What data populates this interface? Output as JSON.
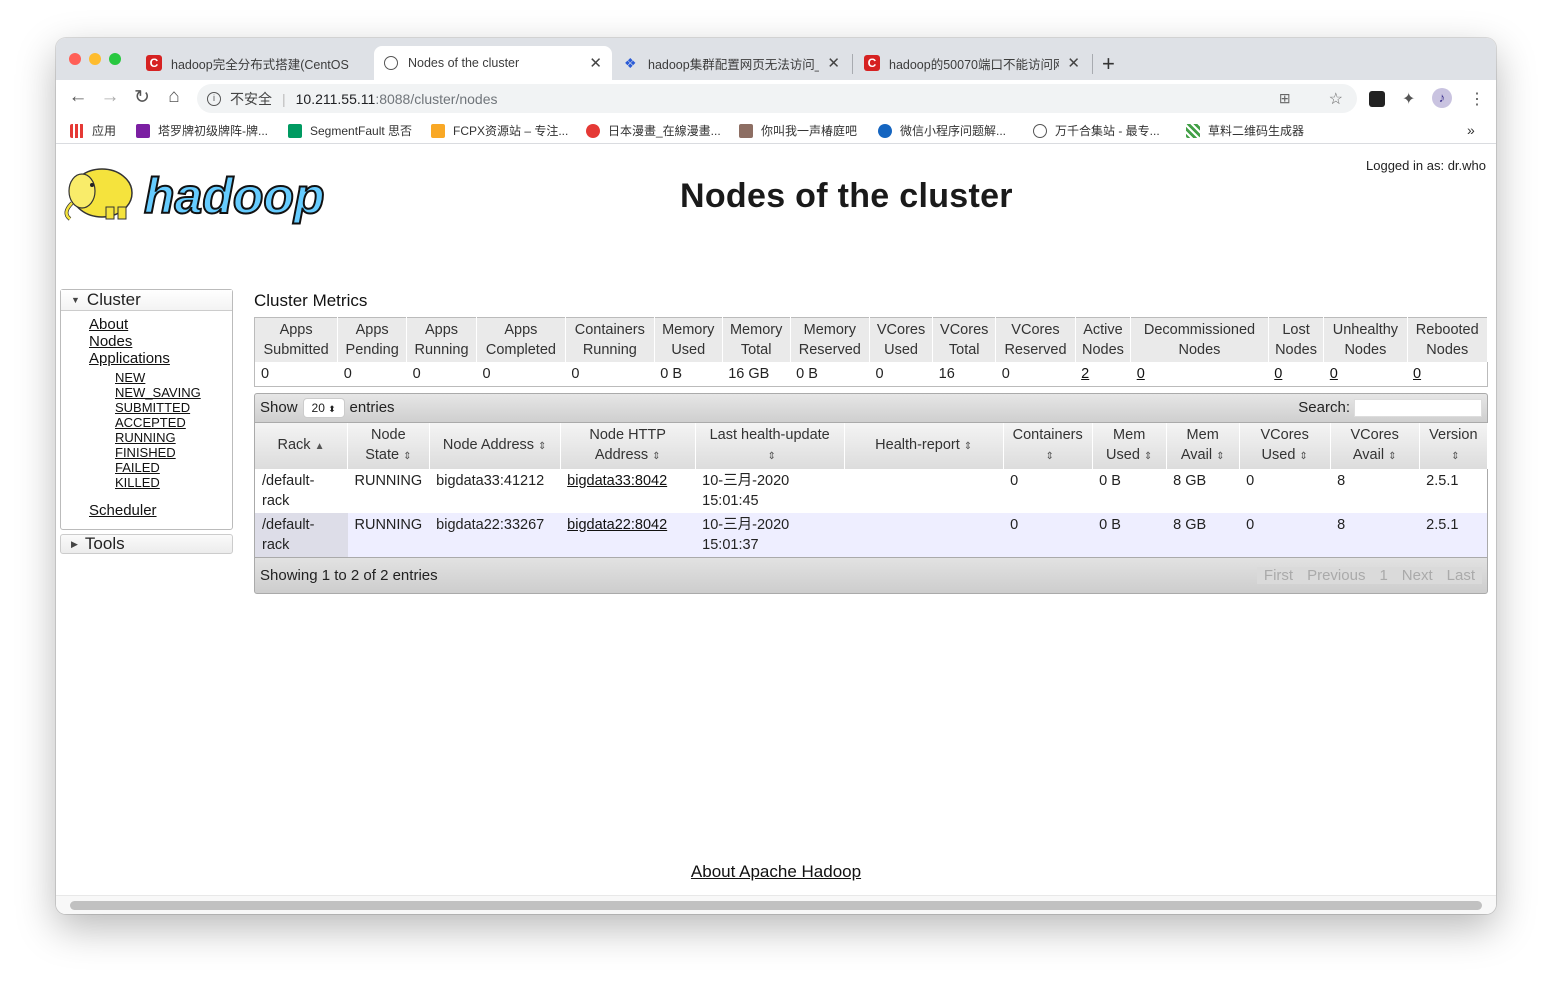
{
  "browser": {
    "tabs": [
      {
        "title": "hadoop完全分布式搭建(CentOS",
        "icon": "csdn-icon"
      },
      {
        "title": "Nodes of the cluster",
        "icon": "globe-icon"
      },
      {
        "title": "hadoop集群配置网页无法访问_",
        "icon": "baidu-icon"
      },
      {
        "title": "hadoop的50070端口不能访问网",
        "icon": "csdn-icon"
      }
    ],
    "close_glyph": "✕",
    "new_tab_glyph": "+",
    "address": {
      "insecure_label": "不安全",
      "separator": "|",
      "host": "10.211.55.11",
      "path": ":8088/cluster/nodes"
    },
    "bookmarks": [
      {
        "label": "应用",
        "color": "#e53935"
      },
      {
        "label": "塔罗牌初级牌阵-牌...",
        "color": "#7b1fa2"
      },
      {
        "label": "SegmentFault 思否",
        "color": "#009a61"
      },
      {
        "label": "FCPX资源站 – 专注...",
        "color": "#f9a825"
      },
      {
        "label": "日本漫畫_在線漫畫...",
        "color": "#e53935"
      },
      {
        "label": "你叫我一声椿庭吧",
        "color": "#5d4037"
      },
      {
        "label": "微信小程序问题解...",
        "color": "#1565c0"
      },
      {
        "label": "万千合集站 - 最专...",
        "color": "#555555"
      },
      {
        "label": "草料二维码生成器",
        "color": "#43a047"
      }
    ],
    "more_glyph": "»"
  },
  "header": {
    "logged_in": "Logged in as: dr.who",
    "title": "Nodes of the cluster",
    "logo_text": "hadoop"
  },
  "nav": {
    "cluster_label": "Cluster",
    "links": [
      "About",
      "Nodes",
      "Applications"
    ],
    "app_states": [
      "NEW",
      "NEW_SAVING",
      "SUBMITTED",
      "ACCEPTED",
      "RUNNING",
      "FINISHED",
      "FAILED",
      "KILLED"
    ],
    "scheduler": "Scheduler",
    "tools_label": "Tools"
  },
  "metrics": {
    "title": "Cluster Metrics",
    "headers": [
      [
        "Apps",
        "Submitted"
      ],
      [
        "Apps",
        "Pending"
      ],
      [
        "Apps",
        "Running"
      ],
      [
        "Apps",
        "Completed"
      ],
      [
        "Containers",
        "Running"
      ],
      [
        "Memory",
        "Used"
      ],
      [
        "Memory",
        "Total"
      ],
      [
        "Memory",
        "Reserved"
      ],
      [
        "VCores",
        "Used"
      ],
      [
        "VCores",
        "Total"
      ],
      [
        "VCores",
        "Reserved"
      ],
      [
        "Active",
        "Nodes"
      ],
      [
        "Decommissioned",
        "Nodes"
      ],
      [
        "Lost",
        "Nodes"
      ],
      [
        "Unhealthy",
        "Nodes"
      ],
      [
        "Rebooted",
        "Nodes"
      ]
    ],
    "values": [
      "0",
      "0",
      "0",
      "0",
      "0",
      "0 B",
      "16 GB",
      "0 B",
      "0",
      "16",
      "0",
      "2",
      "0",
      "0",
      "0",
      "0"
    ]
  },
  "nodes_table": {
    "show_label": "Show",
    "entries_value": "20",
    "entries_label": "entries",
    "search_label": "Search:",
    "headers": [
      [
        "Rack"
      ],
      [
        "Node",
        "State"
      ],
      [
        "Node Address"
      ],
      [
        "Node HTTP",
        "Address"
      ],
      [
        "Last health-update"
      ],
      [
        "Health-report"
      ],
      [
        "Containers"
      ],
      [
        "Mem",
        "Used"
      ],
      [
        "Mem",
        "Avail"
      ],
      [
        "VCores",
        "Used"
      ],
      [
        "VCores",
        "Avail"
      ],
      [
        "Version"
      ]
    ],
    "rows": [
      {
        "rack": [
          "/default-",
          "rack"
        ],
        "state": "RUNNING",
        "address": "bigdata33:41212",
        "http": "bigdata33:8042",
        "health_update": [
          "10-三月-2020",
          "15:01:45"
        ],
        "health_report": "",
        "containers": "0",
        "mem_used": "0 B",
        "mem_avail": "8 GB",
        "vcores_used": "0",
        "vcores_avail": "8",
        "version": "2.5.1"
      },
      {
        "rack": [
          "/default-",
          "rack"
        ],
        "state": "RUNNING",
        "address": "bigdata22:33267",
        "http": "bigdata22:8042",
        "health_update": [
          "10-三月-2020",
          "15:01:37"
        ],
        "health_report": "",
        "containers": "0",
        "mem_used": "0 B",
        "mem_avail": "8 GB",
        "vcores_used": "0",
        "vcores_avail": "8",
        "version": "2.5.1"
      }
    ],
    "info": "Showing 1 to 2 of 2 entries",
    "pager": {
      "first": "First",
      "previous": "Previous",
      "page": "1",
      "next": "Next",
      "last": "Last"
    }
  },
  "footer": {
    "link": "About Apache Hadoop"
  },
  "colors": {
    "hadoop_yellow": "#f5e33d",
    "hadoop_blue": "#66ccff",
    "row_alt": "#eeeeff"
  }
}
